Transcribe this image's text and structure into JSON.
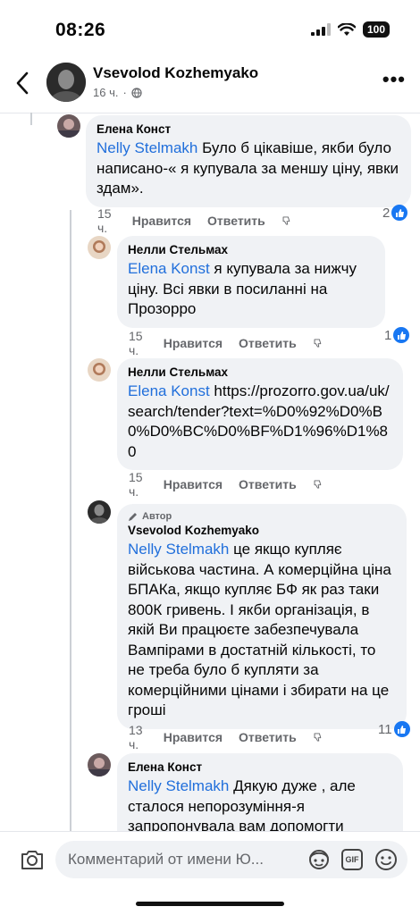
{
  "status_bar": {
    "time": "08:26",
    "battery": "100"
  },
  "header": {
    "name": "Vsevolod Kozhemyako",
    "time": "16 ч.",
    "privacy_icon": "globe-icon"
  },
  "comments": [
    {
      "name": "Елена Конст",
      "mention": "Nelly  Stelmakh",
      "text": " Було б цікавіше, якби було написано-« я купувала за меншу ціну, явки здам».",
      "time": "15 ч.",
      "like": "Нравится",
      "reply": "Ответить",
      "reactions": "2"
    },
    {
      "name": "Нелли Стельмах",
      "mention": "Elena  Konst",
      "text": " я купувала за нижчу ціну. Всі явки в посиланні  на Прозорро",
      "time": "15 ч.",
      "like": "Нравится",
      "reply": "Ответить",
      "reactions": "1"
    },
    {
      "name": "Нелли Стельмах",
      "mention": "Elena  Konst",
      "text": " https://prozorro.gov.ua/uk/search/tender?text=%D0%92%D0%B0%D0%BC%D0%BF%D1%96%D1%80",
      "time": "15 ч.",
      "like": "Нравится",
      "reply": "Ответить",
      "reactions": ""
    },
    {
      "badge": "Автор",
      "name": "Vsevolod Kozhemyako",
      "mention": "Nelly  Stelmakh",
      "text": " це якщо купляє військова частина. А комерційна ціна БПАКа, якщо купляє БФ як раз таки 800К гривень. І якби організація, в якій Ви працюєте забезпечувала Вампірами в достатній кількості, то не треба було б купляти за комерційними цінами і збирати на це гроші",
      "time": "13 ч.",
      "like": "Нравится",
      "reply": "Ответить",
      "reactions": "11"
    },
    {
      "name": "Елена Конст",
      "mention": "Nelly  Stelmakh",
      "text": " Дякую дуже , але сталося непорозуміння-я запропонувала вам допомогти",
      "time": "",
      "like": "",
      "reply": "",
      "reactions": ""
    }
  ],
  "composer": {
    "placeholder": "Комментарий от имени Ю...",
    "gif_label": "GIF"
  },
  "colors": {
    "accent": "#1877f2",
    "mention": "#216fdb",
    "bubble": "#f0f2f5",
    "secondary_text": "#65676b"
  }
}
